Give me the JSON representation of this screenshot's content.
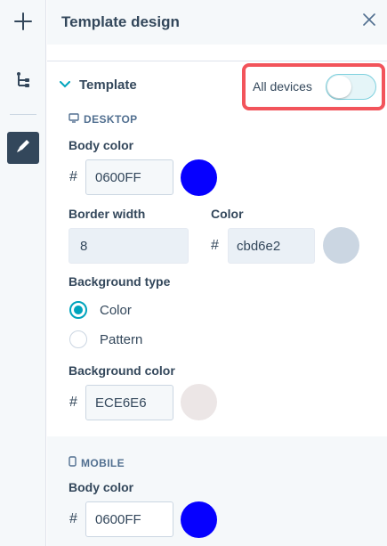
{
  "rail": {
    "items": [
      {
        "icon": "plus-icon"
      },
      {
        "icon": "tree-structure-icon"
      },
      {
        "icon": "pencil-icon"
      }
    ]
  },
  "panel": {
    "title": "Template design",
    "section_title": "Template",
    "all_devices_label": "All devices",
    "all_devices_enabled": false
  },
  "desktop": {
    "label": "DESKTOP",
    "body_color_label": "Body color",
    "body_color_value": "0600FF",
    "body_color_hex": "#0600FF",
    "border_width_label": "Border width",
    "border_width_value": "8",
    "border_color_label": "Color",
    "border_color_value": "cbd6e2",
    "border_color_hex": "#cbd6e2",
    "background_type_label": "Background type",
    "background_type_options": [
      "Color",
      "Pattern"
    ],
    "background_type_selected": "Color",
    "background_color_label": "Background color",
    "background_color_value": "ECE6E6",
    "background_color_hex": "#ECE6E6"
  },
  "mobile": {
    "label": "MOBILE",
    "body_color_label": "Body color",
    "body_color_value": "0600FF",
    "body_color_hex": "#0600FF"
  },
  "colors": {
    "accent": "#00a4bd",
    "highlight_border": "#f2545b",
    "text": "#33475b"
  }
}
